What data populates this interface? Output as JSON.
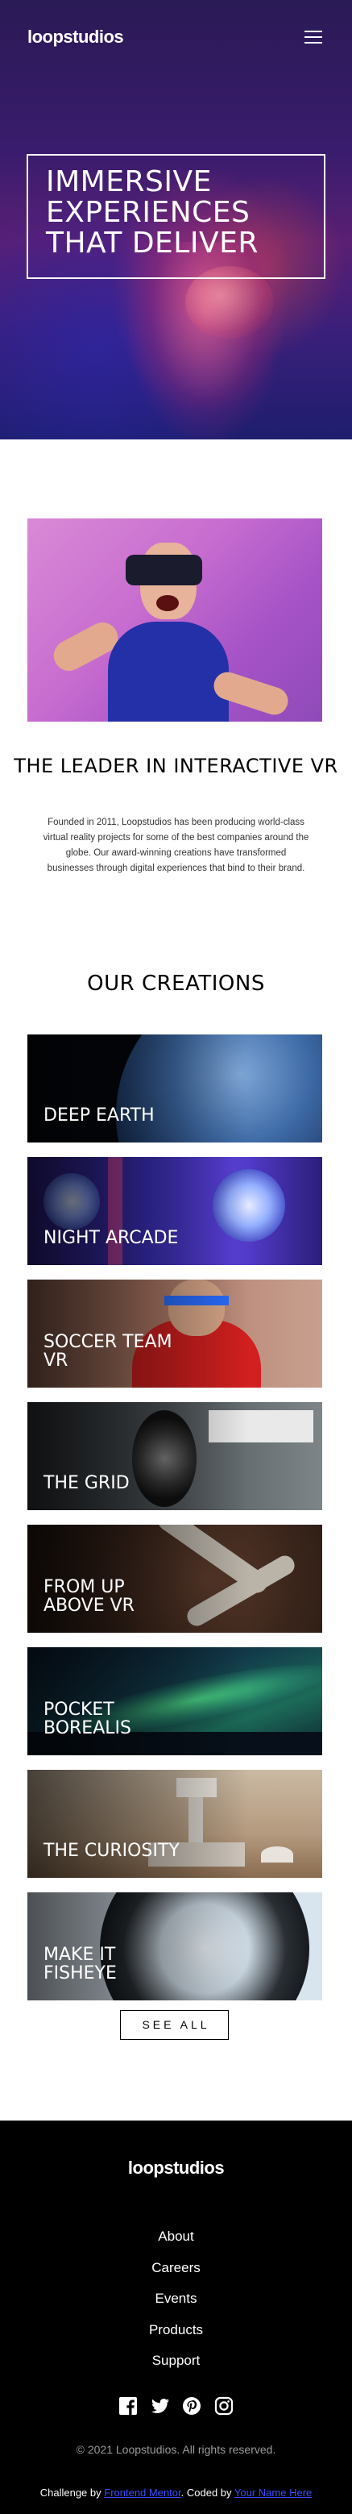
{
  "header": {
    "logo": "loopstudios",
    "menu_icon": "hamburger-menu-icon"
  },
  "hero": {
    "title": "Immersive experiences that deliver"
  },
  "intro": {
    "title": "The leader in interactive VR",
    "text": "Founded in 2011, Loopstudios has been producing world-class virtual reality projects for some of the best companies around the globe. Our award-winning creations have transformed businesses through digital experiences that bind to their brand."
  },
  "creations": {
    "title": "Our creations",
    "items": [
      {
        "label": "Deep earth"
      },
      {
        "label": "Night arcade"
      },
      {
        "label": "Soccer team VR"
      },
      {
        "label": "The grid"
      },
      {
        "label": "From up above VR"
      },
      {
        "label": "Pocket borealis"
      },
      {
        "label": "The curiosity"
      },
      {
        "label": "Make it fisheye"
      }
    ],
    "see_all": "See all"
  },
  "footer": {
    "logo": "loopstudios",
    "nav": [
      "About",
      "Careers",
      "Events",
      "Products",
      "Support"
    ],
    "social_icons": [
      "facebook-icon",
      "twitter-icon",
      "pinterest-icon",
      "instagram-icon"
    ],
    "copyright": "© 2021 Loopstudios. All rights reserved.",
    "attribution": {
      "challenge_prefix": "Challenge by",
      "challenge_link": "Frontend Mentor",
      "coded_prefix": ". Coded by",
      "coded_link": "Your Name Here"
    }
  },
  "colors": {
    "footer_bg": "#000000",
    "link": "#3b4cff",
    "text": "#000000"
  }
}
